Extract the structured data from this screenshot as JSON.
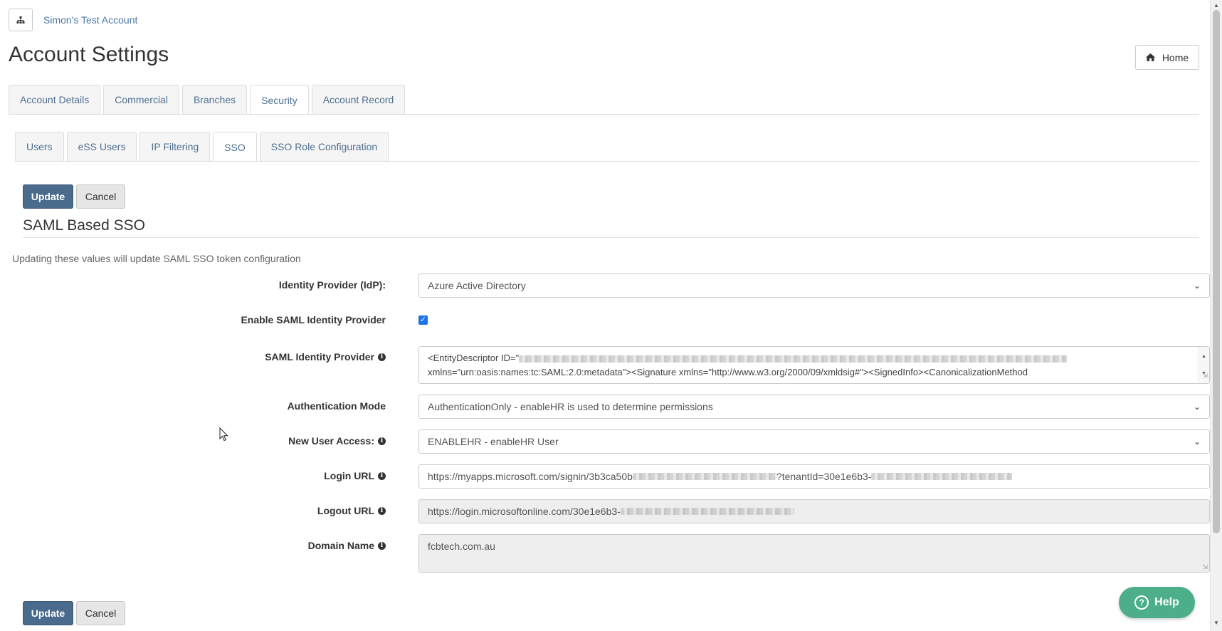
{
  "header": {
    "org_icon": "sitemap-icon",
    "account_name": "Simon's Test Account",
    "title": "Account Settings",
    "home_label": "Home",
    "home_icon": "home-icon"
  },
  "main_tabs": [
    {
      "label": "Account Details"
    },
    {
      "label": "Commercial"
    },
    {
      "label": "Branches"
    },
    {
      "label": "Security",
      "active": true
    },
    {
      "label": "Account Record"
    }
  ],
  "sub_tabs": [
    {
      "label": "Users"
    },
    {
      "label": "eSS Users"
    },
    {
      "label": "IP Filtering"
    },
    {
      "label": "SSO",
      "active": true
    },
    {
      "label": "SSO Role Configuration"
    }
  ],
  "actions": {
    "update_label": "Update",
    "cancel_label": "Cancel"
  },
  "section": {
    "title": "SAML Based SSO",
    "description": "Updating these values will update SAML SSO token configuration"
  },
  "form": {
    "idp": {
      "label": "Identity Provider (IdP):",
      "value": "Azure Active Directory"
    },
    "enable_saml": {
      "label": "Enable SAML Identity Provider",
      "checked": true
    },
    "saml_idp": {
      "label": "SAML Identity Provider",
      "line1_prefix": "<EntityDescriptor ID=\"",
      "line2": "xmlns=\"urn:oasis:names:tc:SAML:2.0:metadata\"><Signature xmlns=\"http://www.w3.org/2000/09/xmldsig#\"><SignedInfo><CanonicalizationMethod"
    },
    "auth_mode": {
      "label": "Authentication Mode",
      "value": "AuthenticationOnly - enableHR is used to determine permissions"
    },
    "new_user_access": {
      "label": "New User Access:",
      "value": "ENABLEHR - enableHR User"
    },
    "login_url": {
      "label": "Login URL",
      "part1": "https://myapps.microsoft.com/signin/3b3ca50b",
      "part2": "?tenantId=30e1e6b3-"
    },
    "logout_url": {
      "label": "Logout URL",
      "value": "https://login.microsoftonline.com/30e1e6b3-"
    },
    "domain_name": {
      "label": "Domain Name",
      "value": "fcbtech.com.au"
    }
  },
  "help": {
    "label": "Help"
  },
  "colors": {
    "primary": "#4a6b8c",
    "link": "#4a77a8",
    "help": "#4caf8a",
    "checkbox": "#1a73e8"
  }
}
